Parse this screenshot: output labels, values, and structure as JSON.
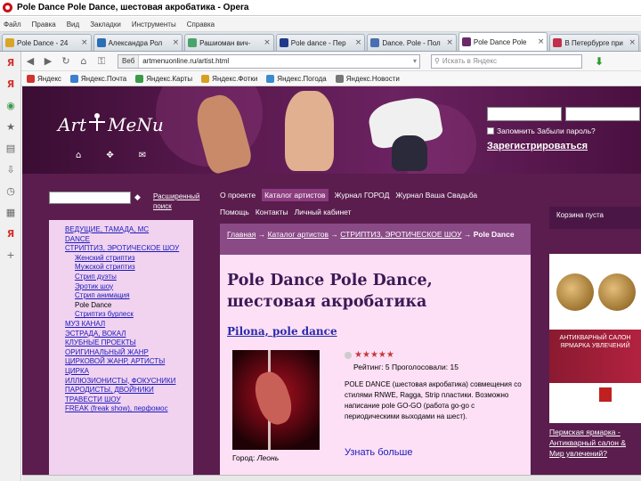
{
  "window": {
    "title": "Pole Dance Pole Dance, шестовая акробатика - Opera"
  },
  "menu": [
    "Файл",
    "Правка",
    "Вид",
    "Закладки",
    "Инструменты",
    "Справка"
  ],
  "tabs": [
    {
      "label": "Pole Dance - 24",
      "color": "#d9a526",
      "active": false
    },
    {
      "label": "Александра Рол",
      "color": "#2a6fb5",
      "active": false
    },
    {
      "label": "Рашиоман вич-",
      "color": "#4aa36a",
      "active": false
    },
    {
      "label": "Pole dance - Пер",
      "color": "#1f3a8a",
      "active": false
    },
    {
      "label": "Dance. Pole - Пол",
      "color": "#4a6fb0",
      "active": false
    },
    {
      "label": "Pole Dance Pole",
      "color": "#6a2a6a",
      "active": true
    },
    {
      "label": "В Петербурге при",
      "color": "#c0304a",
      "active": false
    }
  ],
  "address": {
    "web_label": "Веб",
    "url": "artmenuonline.ru/artist.html",
    "search_placeholder": "Искать в Яндекс"
  },
  "bookmarks": [
    {
      "label": "Яндекс",
      "color": "#d0342c"
    },
    {
      "label": "Яндекс.Почта",
      "color": "#3a7fd0"
    },
    {
      "label": "Яндекс.Карты",
      "color": "#3a9a4a"
    },
    {
      "label": "Яндекс.Фотки",
      "color": "#d8a020"
    },
    {
      "label": "Яндекс.Погода",
      "color": "#3a8ad0"
    },
    {
      "label": "Яндекс.Новости",
      "color": "#777777"
    }
  ],
  "site": {
    "logo_left": "Art",
    "logo_right": "MeNu",
    "remember_label": "Запомнить Забыли пароль?",
    "register_label": "Зарегистрироваться",
    "advanced_search": "Расширенный поиск"
  },
  "topnav": {
    "row1": [
      "О проекте",
      "Каталог артистов",
      "Журнал ГОРОД",
      "Журнал Ваша Свадьба"
    ],
    "row2": [
      "Помощь",
      "Контакты",
      "Личный кабинет"
    ],
    "active_index": 1
  },
  "leftmenu": [
    {
      "label": "ВЕДУЩИЕ, ТАМАДА, МС",
      "sub": false,
      "current": false
    },
    {
      "label": "DANCE",
      "sub": false,
      "current": false
    },
    {
      "label": "СТРИПТИЗ, ЭРОТИЧЕСКОЕ ШОУ",
      "sub": false,
      "current": false
    },
    {
      "label": "Женский стриптиз",
      "sub": true,
      "current": false
    },
    {
      "label": "Мужской стриптиз",
      "sub": true,
      "current": false
    },
    {
      "label": "Стрип дуэты",
      "sub": true,
      "current": false
    },
    {
      "label": "Эротик шоу",
      "sub": true,
      "current": false
    },
    {
      "label": "Стрип анимация",
      "sub": true,
      "current": false
    },
    {
      "label": "Pole Dance",
      "sub": true,
      "current": true
    },
    {
      "label": "Стриптиз бурлеск",
      "sub": true,
      "current": false
    },
    {
      "label": "МУЗ КАНАЛ",
      "sub": false,
      "current": false
    },
    {
      "label": "ЭСТРАДА, ВОКАЛ",
      "sub": false,
      "current": false
    },
    {
      "label": "КЛУБНЫЕ ПРОЕКТЫ",
      "sub": false,
      "current": false
    },
    {
      "label": "ОРИГИНАЛЬНЫЙ ЖАНР",
      "sub": false,
      "current": false
    },
    {
      "label": "ЦИРКОВОЙ ЖАНР, АРТИСТЫ",
      "sub": false,
      "current": false
    },
    {
      "label": "ЦИРКА",
      "sub": false,
      "current": false
    },
    {
      "label": "ИЛЛЮЗИОНИСТЫ, ФОКУСНИКИ",
      "sub": false,
      "current": false
    },
    {
      "label": "ПАРОДИСТЫ, ДВОЙНИКИ",
      "sub": false,
      "current": false
    },
    {
      "label": "ТРАВЕСТИ ШОУ",
      "sub": false,
      "current": false
    },
    {
      "label": "FREAK (freak show), перфомос",
      "sub": false,
      "current": false
    }
  ],
  "breadcrumb": {
    "items": [
      "Главная",
      "Каталог артистов",
      "СТРИПТИЗ, ЭРОТИЧЕСКОЕ ШОУ"
    ],
    "current": "Pole Dance"
  },
  "main": {
    "heading": "Pole Dance Pole Dance, шестовая акробатика",
    "subheading": "Pilona, pole dance",
    "rating_value": 5,
    "rating_max": 5,
    "rating_text": "Рейтинг: 5 Проголосовали: 15",
    "description": "POLE DANCE (шестовая акробатика) совмещения со стилями RNWE, Ragga, Strip пластики. Возможно написание pole GO-GO (работа go-go с периодическими выходами на шест).",
    "city_label": "Город:",
    "city_value": "Леонь",
    "more_label": "Узнать больше"
  },
  "sidebar": {
    "cart": "Корзина пуста",
    "ad_title": "АНТИКВАРНЫЙ САЛОН ЯРМАРКА УВЛЕЧЕНИЙ",
    "ad_link": "Пермская ярмарка - Антикварный салон & Мир увлечений?"
  }
}
